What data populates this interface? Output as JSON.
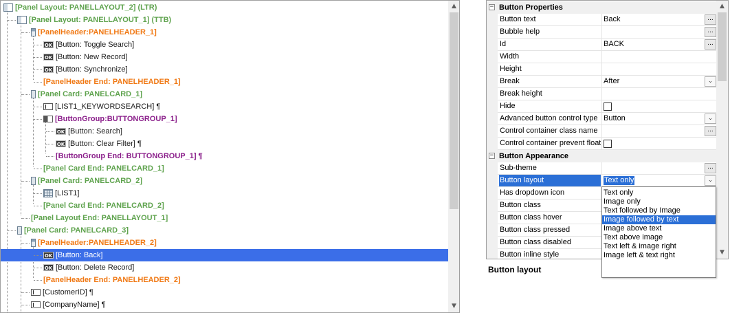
{
  "tree": {
    "rows": [
      {
        "label": "[Panel Layout: PANELLAYOUT_2] (LTR)",
        "style": "green",
        "icon": "layout-icon"
      },
      {
        "label": "[Panel Layout: PANELLAYOUT_1] (TTB)",
        "style": "green",
        "icon": "layout-icon"
      },
      {
        "label": "[PanelHeader:PANELHEADER_1]",
        "style": "orange",
        "icon": "panel-header-icon"
      },
      {
        "label": "[Button: Toggle Search]",
        "style": "plain",
        "icon": "ok-button-icon"
      },
      {
        "label": "[Button: New Record]",
        "style": "plain",
        "icon": "ok-button-icon"
      },
      {
        "label": "[Button: Synchronize]",
        "style": "plain",
        "icon": "ok-button-icon"
      },
      {
        "label": "[PanelHeader End: PANELHEADER_1]",
        "style": "orange",
        "icon": ""
      },
      {
        "label": "[Panel Card: PANELCARD_1]",
        "style": "green",
        "icon": "panel-card-icon"
      },
      {
        "label": "[LIST1_KEYWORDSEARCH] ¶",
        "style": "plain",
        "icon": "text-field-icon"
      },
      {
        "label": "[ButtonGroup:BUTTONGROUP_1]",
        "style": "purple",
        "icon": "button-group-icon"
      },
      {
        "label": "[Button: Search]",
        "style": "plain",
        "icon": "ok-button-icon"
      },
      {
        "label": "[Button: Clear Filter] ¶",
        "style": "plain",
        "icon": "ok-button-icon"
      },
      {
        "label": "[ButtonGroup End: BUTTONGROUP_1] ¶",
        "style": "purple",
        "icon": ""
      },
      {
        "label": "[Panel Card End: PANELCARD_1]",
        "style": "green",
        "icon": ""
      },
      {
        "label": "[Panel Card: PANELCARD_2]",
        "style": "green",
        "icon": "panel-card-icon"
      },
      {
        "label": "[LIST1]",
        "style": "plain",
        "icon": "grid-list-icon"
      },
      {
        "label": "[Panel Card End: PANELCARD_2]",
        "style": "green",
        "icon": ""
      },
      {
        "label": "[Panel Layout End: PANELLAYOUT_1]",
        "style": "green",
        "icon": ""
      },
      {
        "label": "[Panel Card: PANELCARD_3]",
        "style": "green",
        "icon": "panel-card-icon"
      },
      {
        "label": "[PanelHeader:PANELHEADER_2]",
        "style": "orange",
        "icon": "panel-header-icon"
      },
      {
        "label": "[Button: Back]",
        "style": "plain",
        "icon": "ok-button-icon",
        "selected": true
      },
      {
        "label": "[Button: Delete Record]",
        "style": "plain",
        "icon": "ok-button-icon"
      },
      {
        "label": "[PanelHeader End: PANELHEADER_2]",
        "style": "orange",
        "icon": ""
      },
      {
        "label": "[CustomerID] ¶",
        "style": "plain",
        "icon": "text-field-icon"
      },
      {
        "label": "[CompanyName] ¶",
        "style": "plain",
        "icon": "text-field-icon"
      }
    ],
    "ok_icon_text": "OK",
    "scroll_up_arrow": "▲",
    "scroll_down_arrow": "▼"
  },
  "properties": {
    "categories": [
      {
        "title": "Button Properties",
        "toggle": "−",
        "rows": [
          {
            "name": "Button text",
            "value": "Back",
            "editor": "ellipsis"
          },
          {
            "name": "Bubble help",
            "value": "",
            "editor": "ellipsis"
          },
          {
            "name": "Id",
            "value": "BACK",
            "editor": "ellipsis"
          },
          {
            "name": "Width",
            "value": "",
            "editor": ""
          },
          {
            "name": "Height",
            "value": "",
            "editor": ""
          },
          {
            "name": "Break",
            "value": "After",
            "editor": "combo"
          },
          {
            "name": "Break height",
            "value": "",
            "editor": ""
          },
          {
            "name": "Hide",
            "value": "",
            "editor": "checkbox"
          },
          {
            "name": "Advanced button control type",
            "value": "Button",
            "editor": "combo"
          },
          {
            "name": "Control container class name",
            "value": "",
            "editor": "ellipsis"
          },
          {
            "name": "Control container prevent float",
            "value": "",
            "editor": "checkbox"
          }
        ]
      },
      {
        "title": "Button Appearance",
        "toggle": "−",
        "rows": [
          {
            "name": "Sub-theme",
            "value": "",
            "editor": "ellipsis"
          },
          {
            "name": "Button layout",
            "value": "Text only",
            "editor": "combo",
            "selected": true
          },
          {
            "name": "Has dropdown icon",
            "value": "",
            "editor": ""
          },
          {
            "name": "Button class",
            "value": "",
            "editor": ""
          },
          {
            "name": "Button class hover",
            "value": "",
            "editor": ""
          },
          {
            "name": "Button class pressed",
            "value": "",
            "editor": ""
          },
          {
            "name": "Button class disabled",
            "value": "",
            "editor": ""
          },
          {
            "name": "Button inline style",
            "value": "",
            "editor": ""
          }
        ]
      }
    ],
    "ellipsis_text": "...",
    "combo_arrow": "⌄"
  },
  "dropdown": {
    "options": [
      "Text only",
      "Image only",
      "Text followed by Image",
      "Image followed by text",
      "Image above text",
      "Text above image",
      "Text left & image right",
      "Image left & text right"
    ],
    "highlighted_index": 3
  },
  "description": {
    "title": "Button layout"
  }
}
